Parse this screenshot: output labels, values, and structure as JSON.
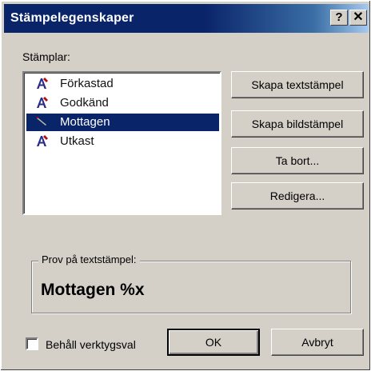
{
  "window": {
    "title": "Stämpelegenskaper",
    "help_glyph": "?",
    "close_glyph": "✕"
  },
  "stamps_label": "Stämplar:",
  "stamps": [
    {
      "label": "Förkastad",
      "icon": "text-stamp-icon",
      "selected": false
    },
    {
      "label": "Godkänd",
      "icon": "text-stamp-icon",
      "selected": false
    },
    {
      "label": "Mottagen",
      "icon": "image-stamp-icon",
      "selected": true
    },
    {
      "label": "Utkast",
      "icon": "text-stamp-icon",
      "selected": false
    }
  ],
  "buttons": {
    "create_text": "Skapa textstämpel",
    "create_image": "Skapa bildstämpel",
    "delete": "Ta bort...",
    "edit": "Redigera...",
    "ok": "OK",
    "cancel": "Avbryt"
  },
  "preview": {
    "group_label": "Prov på textstämpel:",
    "text": "Mottagen %x"
  },
  "keep_tool": {
    "label": "Behåll verktygsval",
    "checked": false
  },
  "colors": {
    "selection": "#0a246a",
    "title_bar": "#0a246a",
    "stamp_icon_letter": "#2a2a8a",
    "stamp_icon_mark": "#b01010"
  }
}
